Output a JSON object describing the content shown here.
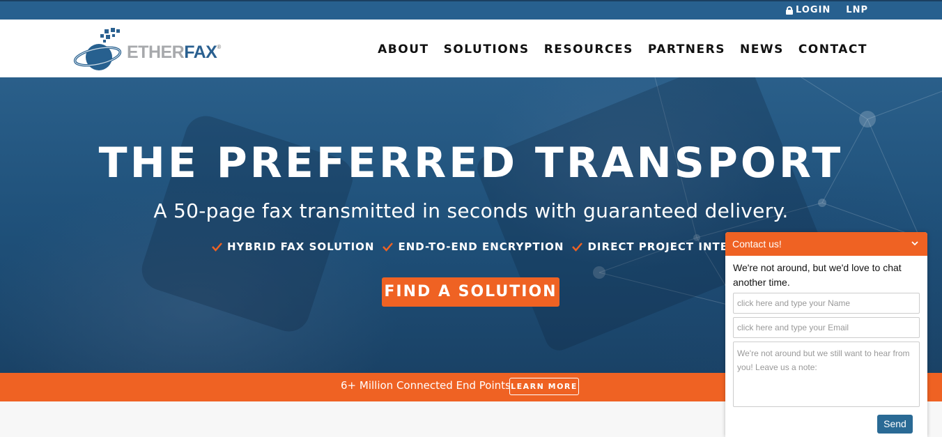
{
  "topbar": {
    "login_label": "LOGIN",
    "lnp_label": "LNP"
  },
  "brand": {
    "logo_part1": "ETHER",
    "logo_part2": "FAX",
    "registered": "®"
  },
  "nav": {
    "items": [
      "ABOUT",
      "SOLUTIONS",
      "RESOURCES",
      "PARTNERS",
      "NEWS",
      "CONTACT"
    ]
  },
  "hero": {
    "title": "THE PREFERRED TRANSPORT",
    "subtitle": "A 50-page fax transmitted in seconds with guaranteed delivery.",
    "features": [
      "HYBRID FAX SOLUTION",
      "END-TO-END ENCRYPTION",
      "DIRECT PROJECT INTEGRATION"
    ],
    "cta_label": "FIND A SOLUTION"
  },
  "banner": {
    "message": "6+ Million Connected End Points",
    "learn_more": "LEARN MORE"
  },
  "chat": {
    "title": "Contact us!",
    "message": "We're not around, but we'd love to chat another time.",
    "name_placeholder": "click here and type your Name",
    "email_placeholder": "click here and type your Email",
    "note_placeholder": "We're not around but we still want to hear from you! Leave us a note:",
    "send_label": "Send"
  },
  "colors": {
    "brand_blue": "#27608f",
    "accent_orange": "#ef6223",
    "send_blue": "#2a6a95"
  },
  "icons": {
    "lock": "lock-icon",
    "check": "check-icon",
    "chevron": "chevron-down-icon",
    "logo": "globe-logo-icon"
  }
}
